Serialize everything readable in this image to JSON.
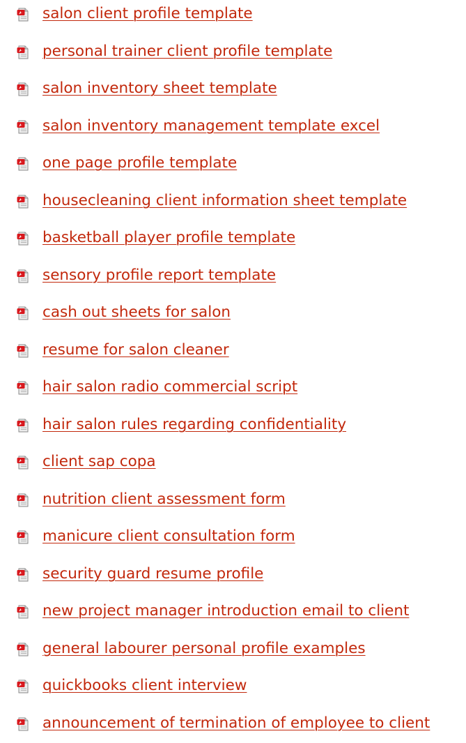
{
  "icon_name": "pdf-document-icon",
  "link_color": "#c2280c",
  "items": [
    {
      "label": "salon client profile template"
    },
    {
      "label": "personal trainer client profile template"
    },
    {
      "label": "salon inventory sheet template"
    },
    {
      "label": "salon inventory management template excel"
    },
    {
      "label": "one page profile template"
    },
    {
      "label": "housecleaning client information sheet template"
    },
    {
      "label": "basketball player profile template"
    },
    {
      "label": "sensory profile report template"
    },
    {
      "label": "cash out sheets for salon"
    },
    {
      "label": "resume for salon cleaner"
    },
    {
      "label": "hair salon radio commercial script"
    },
    {
      "label": "hair salon rules regarding confidentiality"
    },
    {
      "label": "client sap copa"
    },
    {
      "label": "nutrition client assessment form"
    },
    {
      "label": "manicure client consultation form"
    },
    {
      "label": "security guard resume profile"
    },
    {
      "label": "new project manager introduction email to client"
    },
    {
      "label": "general labourer personal profile examples"
    },
    {
      "label": "quickbooks client interview"
    },
    {
      "label": "announcement of termination of employee to client"
    }
  ]
}
